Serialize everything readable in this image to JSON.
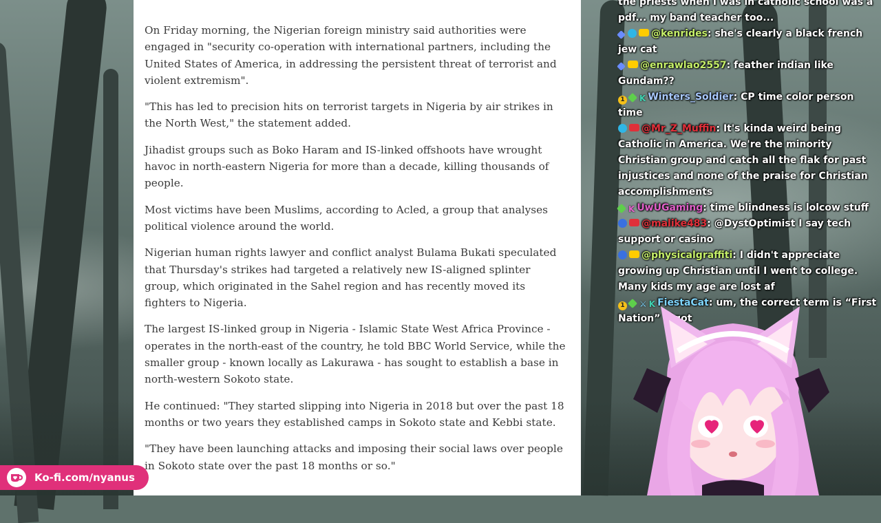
{
  "article": {
    "paragraphs": [
      "On Friday morning, the Nigerian foreign ministry said authorities were engaged in \"security co-operation with international partners, including the United States of America, in addressing the persistent threat of terrorist and violent extremism\".",
      "\"This has led to precision hits on terrorist targets in Nigeria by air strikes in the North West,\" the statement added.",
      "Jihadist groups such as Boko Haram and IS-linked offshoots have wrought havoc in north-eastern Nigeria for more than a decade, killing thousands of people.",
      "Most victims have been Muslims, according to Acled, a group that analyses political violence around the world.",
      "Nigerian human rights lawyer and conflict analyst Bulama Bukati speculated that Thursday's strikes had targeted a relatively new IS-aligned splinter group, which originated in the Sahel region and has recently moved its fighters to Nigeria.",
      "The largest IS-linked group in Nigeria - Islamic State West Africa Province - operates in the north-east of the country, he told BBC World Service, while the smaller group - known locally as Lakurawa - has sought to establish a base in north-western Sokoto state.",
      "He continued: \"They started slipping into Nigeria in 2018 but over the past 18 months or two years they established camps in Sokoto state and Kebbi state.",
      "\"They have been launching attacks and imposing their social laws over people in Sokoto state over the past 18 months or so.\""
    ]
  },
  "chat": {
    "messages": [
      {
        "user": "",
        "user_color": "#ffffff",
        "text": "the priests when I was in catholic school was a pdf... my band teacher too...",
        "badges": []
      },
      {
        "user": "@kenrides",
        "user_color": "#c6f06a",
        "text": "she's clearly a black french jew cat",
        "badges": [
          "tool-icon",
          "star-icon",
          "youtube-icon"
        ]
      },
      {
        "user": "@enrawlao2557",
        "user_color": "#c6f06a",
        "text": "feather indian like Gundam??",
        "badges": [
          "tool-icon",
          "youtube-icon"
        ]
      },
      {
        "user": "Winters_Soldier",
        "user_color": "#a9c9ff",
        "text": "CP time color person time",
        "badges": [
          "one-icon",
          "sparkle-icon",
          "k-icon"
        ]
      },
      {
        "user": "@Mr_Z_Muffin",
        "user_color": "#e0303a",
        "text": "It's kinda weird being Catholic in America. We're the minority Christian group and catch all the flak for past injustices and none of the praise for Christian accomplishments",
        "badges": [
          "star-icon",
          "youtube-red-icon"
        ]
      },
      {
        "user": "UwUGaming",
        "user_color": "#e060c8",
        "text": "time blindness is lolcow stuff",
        "badges": [
          "sparkle-icon",
          "k-pink-icon"
        ]
      },
      {
        "user": "@malike483",
        "user_color": "#e0303a",
        "text": "@DystOptimist I say tech support or casino",
        "badges": [
          "blue-icon",
          "youtube-red-icon"
        ]
      },
      {
        "user": "@physicalgraffiti",
        "user_color": "#c6f06a",
        "text": "I didn't appreciate growing up Christian until I went to college. Many kids my age are lost af",
        "badges": [
          "blue-icon",
          "youtube-icon"
        ]
      },
      {
        "user": "FiestaCat",
        "user_color": "#7fd6ff",
        "text": "um, the correct term is “First Nation” bigot",
        "badges": [
          "one-icon",
          "sparkle-icon",
          "sword-icon",
          "k-icon"
        ]
      }
    ]
  },
  "kofi": {
    "label": "Ko-fi.com/nyanus",
    "brand_color": "#e0307a"
  }
}
